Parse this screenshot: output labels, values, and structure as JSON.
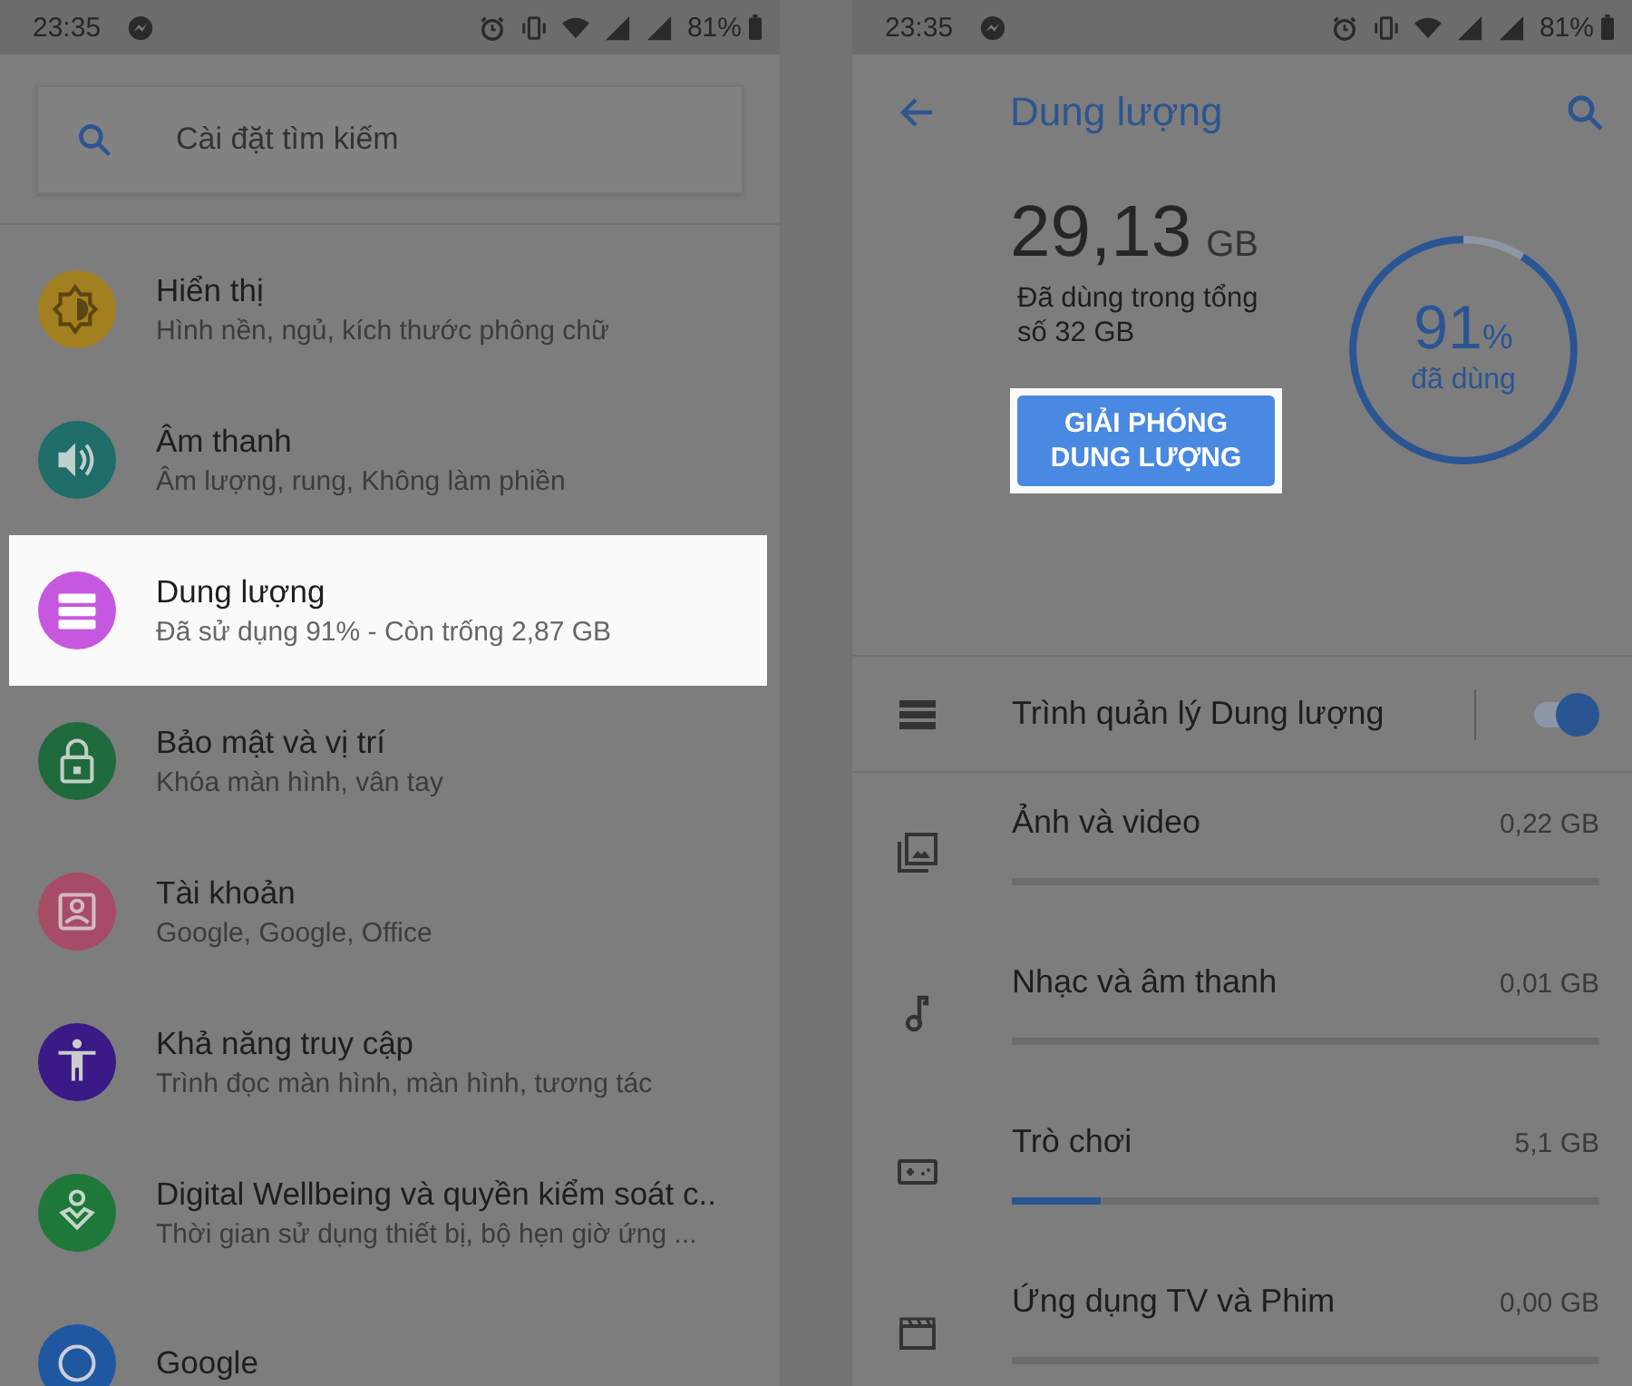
{
  "left": {
    "status_bar": {
      "time": "23:35",
      "battery": "81%"
    },
    "search": {
      "placeholder": "Cài đặt tìm kiếm"
    },
    "items": [
      {
        "title": "Hiển thị",
        "subtitle": "Hình nền, ngủ, kích thước phông chữ",
        "color": "#a3801f",
        "highlighted": false
      },
      {
        "title": "Âm thanh",
        "subtitle": "Âm lượng, rung, Không làm phiền",
        "color": "#1f6d68",
        "highlighted": false
      },
      {
        "title": "Dung lượng",
        "subtitle": "Đã sử dụng 91% - Còn trống 2,87 GB",
        "color": "#c658e0",
        "highlighted": true
      },
      {
        "title": "Bảo mật và vị trí",
        "subtitle": "Khóa màn hình, vân tay",
        "color": "#1f6a3c",
        "highlighted": false
      },
      {
        "title": "Tài khoản",
        "subtitle": "Google, Google, Office",
        "color": "#a64c66",
        "highlighted": false
      },
      {
        "title": "Khả năng truy cập",
        "subtitle": "Trình đọc màn hình, màn hình, tương tác",
        "color": "#3a1a86",
        "highlighted": false
      },
      {
        "title": "Digital Wellbeing và quyền kiểm soát c..",
        "subtitle": "Thời gian sử dụng thiết bị, bộ hẹn giờ ứng ...",
        "color": "#1e783a",
        "highlighted": false
      },
      {
        "title": "Google",
        "color": "#1f58a0",
        "highlighted": false
      }
    ]
  },
  "right": {
    "status_bar": {
      "time": "23:35",
      "battery": "81%"
    },
    "title": "Dung lượng",
    "used": {
      "amount": "29,13",
      "unit": "GB",
      "caption": "Đã dùng trong tổng số 32 GB"
    },
    "gauge": {
      "level": 0.91,
      "percent": "91",
      "percent_sign": "%",
      "caption": "đã dùng"
    },
    "free_button": {
      "label": "GIẢI PHÓNG DUNG LƯỢNG",
      "highlighted": true
    },
    "manager": {
      "label": "Trình quản lý Dung lượng",
      "on": true
    },
    "categories": [
      {
        "name": "Ảnh và video",
        "size": "0,22 GB"
      },
      {
        "name": "Nhạc và âm thanh",
        "size": "0,01 GB"
      },
      {
        "name": "Trò chơi",
        "size": "5,1 GB",
        "level": 0.15
      },
      {
        "name": "Ứng dụng TV và Phim",
        "size": "0,00 GB"
      }
    ]
  }
}
